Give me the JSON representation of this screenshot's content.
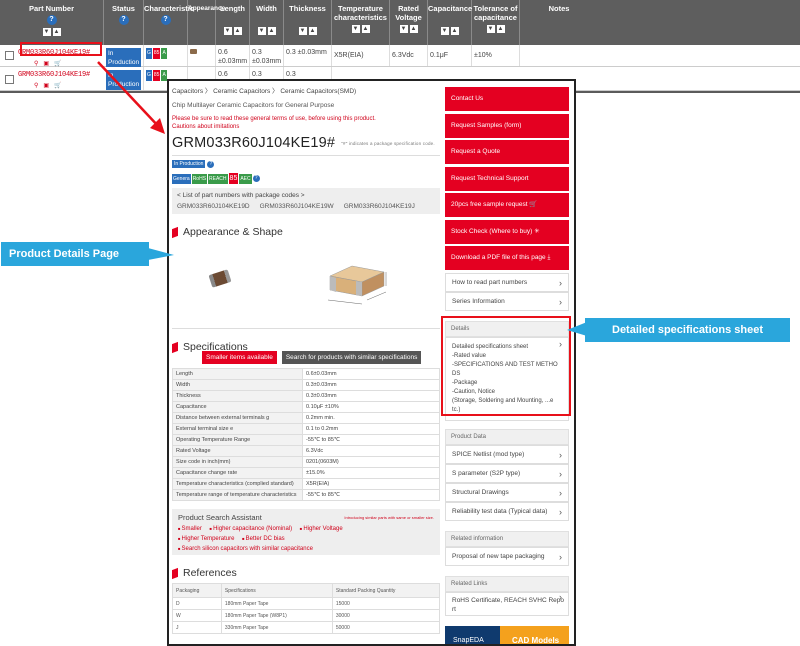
{
  "table": {
    "headers": [
      "Part Number",
      "Status",
      "Characteristic",
      "Appearance",
      "Length",
      "Width",
      "Thickness",
      "Temperature characteristics",
      "Rated Voltage",
      "Capacitance",
      "Tolerance of capacitance",
      "Notes"
    ],
    "rows": [
      {
        "part": "GRM033R60J104KE19#",
        "status": "In Production",
        "length": "0.6 ±0.03mm",
        "width": "0.3 ±0.03mm",
        "thickness": "0.3 ±0.03mm",
        "temp": "X5R(EIA)",
        "voltage": "6.3Vdc",
        "capacitance": "0.1μF",
        "tolerance": "±10%"
      },
      {
        "part": "GRM033R60J104KE19#",
        "status": "In Production",
        "length": "0.6",
        "width": "0.3",
        "thickness": "0.3",
        "temp": "",
        "voltage": "",
        "capacitance": "",
        "tolerance": ""
      }
    ]
  },
  "product": {
    "breadcrumb": "Capacitors 〉 Ceramic Capacitors 〉 Ceramic Capacitors(SMD)",
    "subtitle": "Chip Multilayer Ceramic Capacitors for General Purpose",
    "terms_link": "Please be sure to read these general terms of use, before using this product.",
    "cautions_link": "Cautions about imitations",
    "part_number": "GRM033R60J104KE19#",
    "pn_note": "\"#\" indicates a package specification code.",
    "status": "In Production",
    "badges": [
      "Genera",
      "RoHS",
      "REACH",
      "85",
      "AEC"
    ],
    "pkg_title": "< List of part numbers with package codes >",
    "pkg_codes": [
      "GRM033R60J104KE19D",
      "GRM033R60J104KE19W",
      "GRM033R60J104KE19J"
    ],
    "appearance_title": "Appearance & Shape",
    "specs_title": "Specifications",
    "smaller_btn": "Smaller items available",
    "similar_btn": "Search for products with similar specifications",
    "specs": [
      [
        "Length",
        "0.6±0.03mm"
      ],
      [
        "Width",
        "0.3±0.03mm"
      ],
      [
        "Thickness",
        "0.3±0.03mm"
      ],
      [
        "Capacitance",
        "0.10μF ±10%"
      ],
      [
        "Distance between external terminals g",
        "0.2mm min."
      ],
      [
        "External terminal size e",
        "0.1 to 0.2mm"
      ],
      [
        "Operating Temperature Range",
        "-55℃ to 85℃"
      ],
      [
        "Rated Voltage",
        "6.3Vdc"
      ],
      [
        "Size code in inch(mm)",
        "0201(0603M)"
      ],
      [
        "Capacitance change rate",
        "±15.0%"
      ],
      [
        "Temperature characteristics (complied standard)",
        "X5R(EIA)"
      ],
      [
        "Temperature range of temperature characteristics",
        "-55℃ to 85℃"
      ]
    ],
    "assistant_title": "Product Search Assistant",
    "assistant_note": "Introducing similar parts with same or smaller size.",
    "assistant_links": [
      "Smaller",
      "Higher capacitance (Nominal)",
      "Higher Voltage",
      "Higher Temperature",
      "Better DC bias",
      "Search silicon capacitors with similar capacitance"
    ],
    "references_title": "References",
    "ref_headers": [
      "Packaging",
      "Specifications",
      "Standard Packing Quantity"
    ],
    "ref_rows": [
      [
        "D",
        "180mm Paper Tape",
        "15000"
      ],
      [
        "W",
        "180mm Paper Tape (W8P1)",
        "30000"
      ],
      [
        "J",
        "330mm Paper Tape",
        "50000"
      ]
    ]
  },
  "sidebar": {
    "red_buttons": [
      "Contact Us",
      "Request Samples (form)",
      "Request a Quote",
      "Request Technical Support",
      "20pcs free sample request",
      "Stock Check (Where to buy)",
      "Download a PDF file of this page"
    ],
    "links": [
      "How to read part numbers",
      "Series Information"
    ],
    "details_title": "Details",
    "details_text": [
      "Detailed specifications sheet",
      "-Rated value",
      "-SPECIFICATIONS AND TEST METHO",
      "DS",
      "-Package",
      "-Caution, Notice",
      "(Storage, Soldering and Mounting, ...e",
      "tc.)"
    ],
    "product_data_title": "Product Data",
    "product_data_links": [
      "SPICE Netlist (mod type)",
      "S parameter (S2P type)",
      "Structural Drawings",
      "Reliability test data (Typical data)"
    ],
    "related_info_title": "Related information",
    "related_info_links": [
      "Proposal of new tape packaging"
    ],
    "related_links_title": "Related Links",
    "related_links": [
      "RoHS Certificate, REACH SVHC Repo",
      "rt"
    ],
    "snapeda": "SnapEDA",
    "cad": "CAD Models"
  },
  "callouts": {
    "left": "Product Details Page",
    "right": "Detailed specifications sheet"
  },
  "colors": {
    "accent_red": "#e40021",
    "callout_blue": "#2aa6dc",
    "status_blue": "#2a6ebb"
  }
}
